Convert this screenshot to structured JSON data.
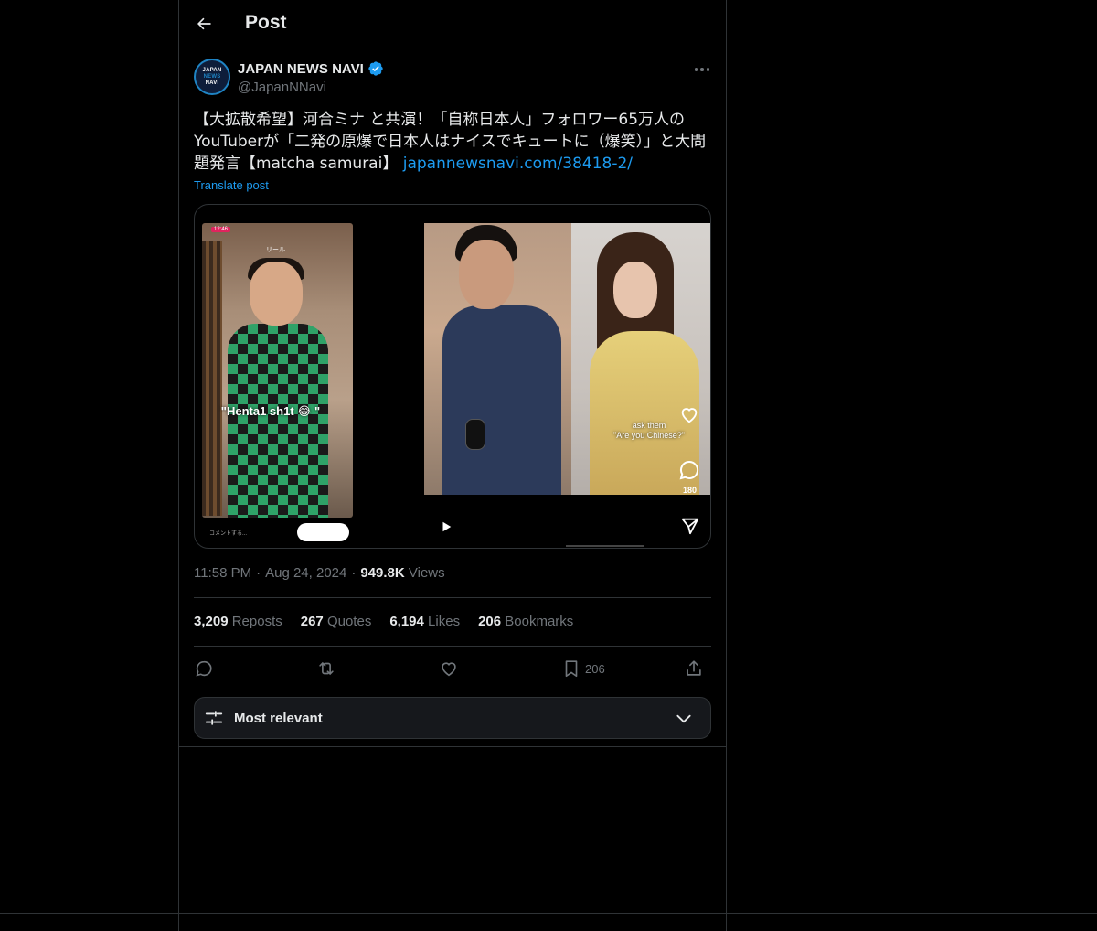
{
  "header": {
    "title": "Post"
  },
  "author": {
    "name": "JAPAN NEWS NAVI",
    "handle": "@JapanNNavi",
    "avatar_text": [
      "JAPAN",
      "NEWS",
      "NAVI"
    ]
  },
  "post": {
    "text": "【大拡散希望】河合ミナ と共演！「自称日本人」フォロワー65万人のYouTuberが「二発の原爆で日本人はナイスでキュートに（爆笑）」と大問題発言【matcha samurai】 ",
    "link": "japannewsnavi.com/38418-2/",
    "translate_label": "Translate post"
  },
  "media": {
    "left_caption": "\"Henta1 sh1t 😂 \"",
    "left_badge": "12:46",
    "left_tab": "リール",
    "left_comment_hint": "コメントする...",
    "right_caption_1": "ask them",
    "right_caption_2": "\"Are you Chinese?\"",
    "comment_count": "180"
  },
  "meta": {
    "time": "11:58 PM",
    "separator": "·",
    "date": "Aug 24, 2024",
    "views_count": "949.8K",
    "views_label": "Views"
  },
  "stats": {
    "reposts_count": "3,209",
    "reposts_label": "Reposts",
    "quotes_count": "267",
    "quotes_label": "Quotes",
    "likes_count": "6,194",
    "likes_label": "Likes",
    "bookmarks_count": "206",
    "bookmarks_label": "Bookmarks"
  },
  "actions": {
    "reply_icon": "reply-icon",
    "repost_icon": "repost-icon",
    "like_icon": "heart-icon",
    "bookmark_icon": "bookmark-icon",
    "bookmark_count": "206",
    "share_icon": "share-icon"
  },
  "sort": {
    "label": "Most relevant"
  },
  "colors": {
    "accent": "#1d9bf0",
    "muted": "#71767b",
    "border": "#2f3336",
    "background": "#000000"
  }
}
